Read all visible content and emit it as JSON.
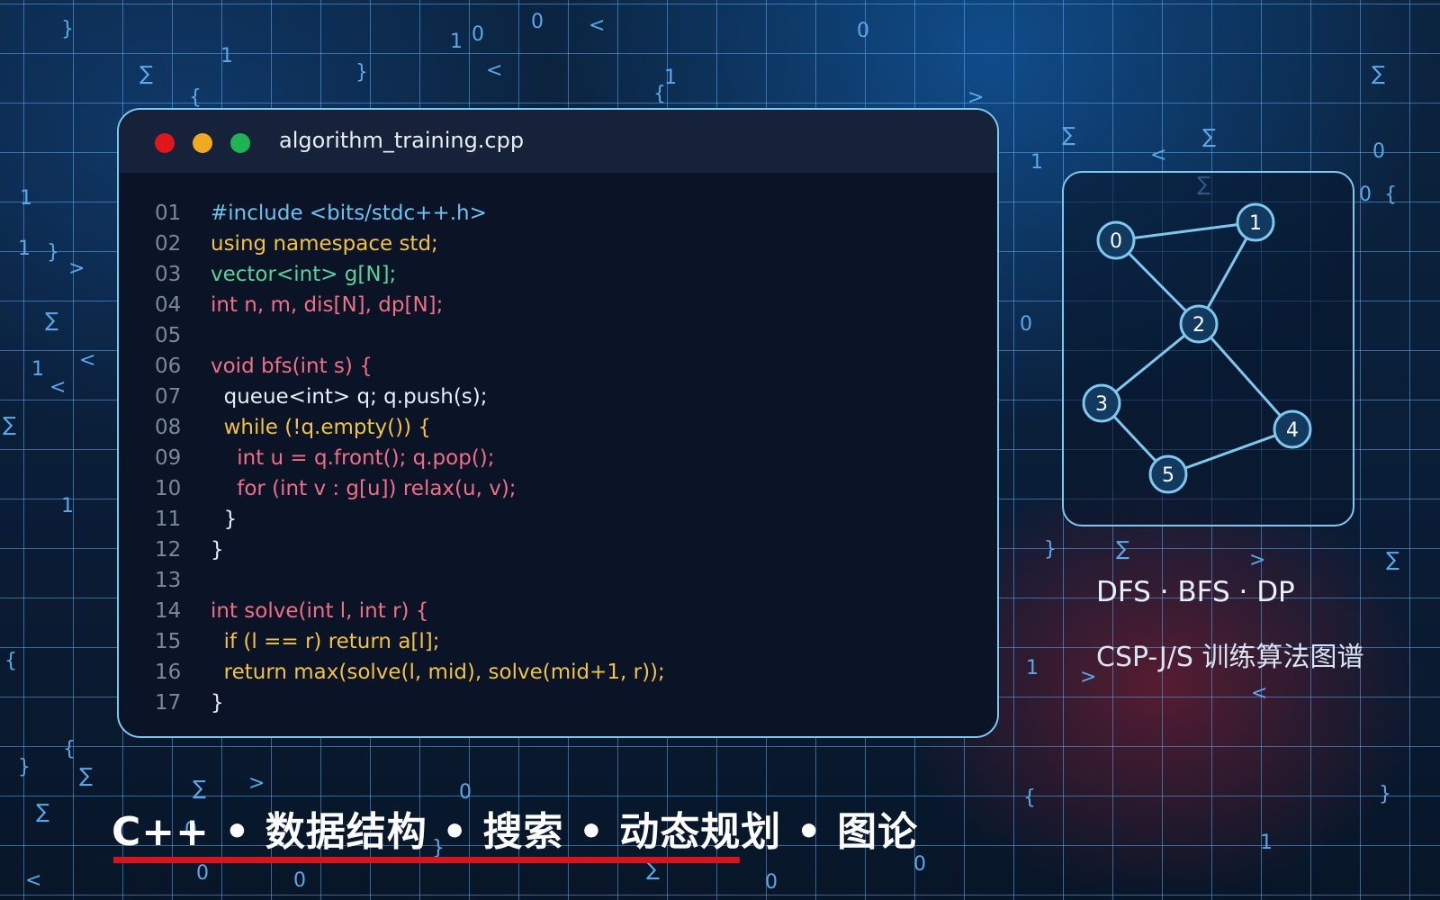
{
  "editor": {
    "filename": "algorithm_training.cpp",
    "window_buttons": [
      "close",
      "minimize",
      "maximize"
    ],
    "colors": {
      "red": "#e0161d",
      "yellow": "#f0a920",
      "green": "#1fb451"
    },
    "lines": [
      {
        "no": "01",
        "text": "#include <bits/stdc++.h>",
        "color": "#6cc1ee"
      },
      {
        "no": "02",
        "text": "using namespace std;",
        "color": "#f0c24a"
      },
      {
        "no": "03",
        "text": "vector<int> g[N];",
        "color": "#57d39a"
      },
      {
        "no": "04",
        "text": "int n, m, dis[N], dp[N];",
        "color": "#ee6f86"
      },
      {
        "no": "05",
        "text": "",
        "color": "#e6edf6"
      },
      {
        "no": "06",
        "text": "void bfs(int s) {",
        "color": "#ee6f86"
      },
      {
        "no": "07",
        "text": "  queue<int> q; q.push(s);",
        "color": "#e6edf6"
      },
      {
        "no": "08",
        "text": "  while (!q.empty()) {",
        "color": "#f0c24a"
      },
      {
        "no": "09",
        "text": "    int u = q.front(); q.pop();",
        "color": "#ee6f86"
      },
      {
        "no": "10",
        "text": "    for (int v : g[u]) relax(u, v);",
        "color": "#ee6f86"
      },
      {
        "no": "11",
        "text": "  }",
        "color": "#e6edf6"
      },
      {
        "no": "12",
        "text": "}",
        "color": "#e6edf6"
      },
      {
        "no": "13",
        "text": "",
        "color": "#e6edf6"
      },
      {
        "no": "14",
        "text": "int solve(int l, int r) {",
        "color": "#ee6f86"
      },
      {
        "no": "15",
        "text": "  if (l == r) return a[l];",
        "color": "#f0c24a"
      },
      {
        "no": "16",
        "text": "  return max(solve(l, mid), solve(mid+1, r));",
        "color": "#f0c24a"
      },
      {
        "no": "17",
        "text": "}",
        "color": "#e6edf6"
      }
    ]
  },
  "graph": {
    "nodes": [
      "0",
      "1",
      "2",
      "3",
      "4",
      "5"
    ],
    "edges": [
      [
        "0",
        "1"
      ],
      [
        "0",
        "2"
      ],
      [
        "1",
        "2"
      ],
      [
        "2",
        "3"
      ],
      [
        "2",
        "4"
      ],
      [
        "3",
        "5"
      ],
      [
        "5",
        "4"
      ]
    ],
    "node_color": "#7ec8f0"
  },
  "caption": {
    "line1": "DFS · BFS · DP",
    "line2": "CSP-J/S 训练算法图谱"
  },
  "topics": {
    "text": "C++ • 数据结构 • 搜索 • 动态规划 • 图论",
    "underline_color": "#d9121b"
  },
  "background_symbols": [
    "}",
    "1",
    "0",
    "0",
    "<",
    "1",
    "∑",
    "}",
    "<",
    "{",
    "{",
    "1",
    "0",
    ">",
    "∑",
    "∑",
    "1",
    "<",
    "∑",
    "∑",
    "0",
    "0",
    "{",
    "1",
    "1",
    "}",
    ">",
    "∑",
    "<",
    "1",
    "<",
    "∑",
    "1",
    "{",
    "{",
    "}",
    "∑",
    "∑",
    ">",
    "0",
    "∑",
    "0",
    "}",
    "0",
    "0",
    "∑",
    "0",
    "0",
    "<",
    "0",
    "∑",
    "}",
    ">",
    "∑",
    "1",
    ">",
    "<",
    "{",
    "}",
    "1"
  ]
}
